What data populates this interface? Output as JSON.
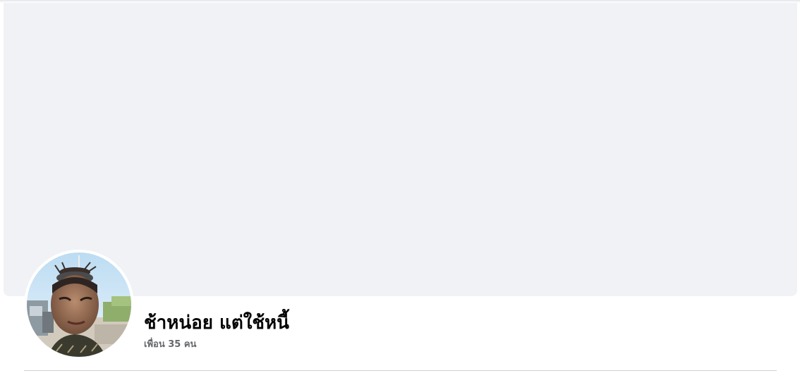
{
  "profile": {
    "name": "ช้าหน่อย แต่ใช้หนี้",
    "friends": "เพื่อน 35 คน"
  },
  "colors": {
    "cover_background": "#f0f2f5",
    "name_text": "#050505",
    "secondary_text": "#65676b",
    "divider": "#ced0d4"
  },
  "icons": {
    "avatar": "profile-photo"
  }
}
